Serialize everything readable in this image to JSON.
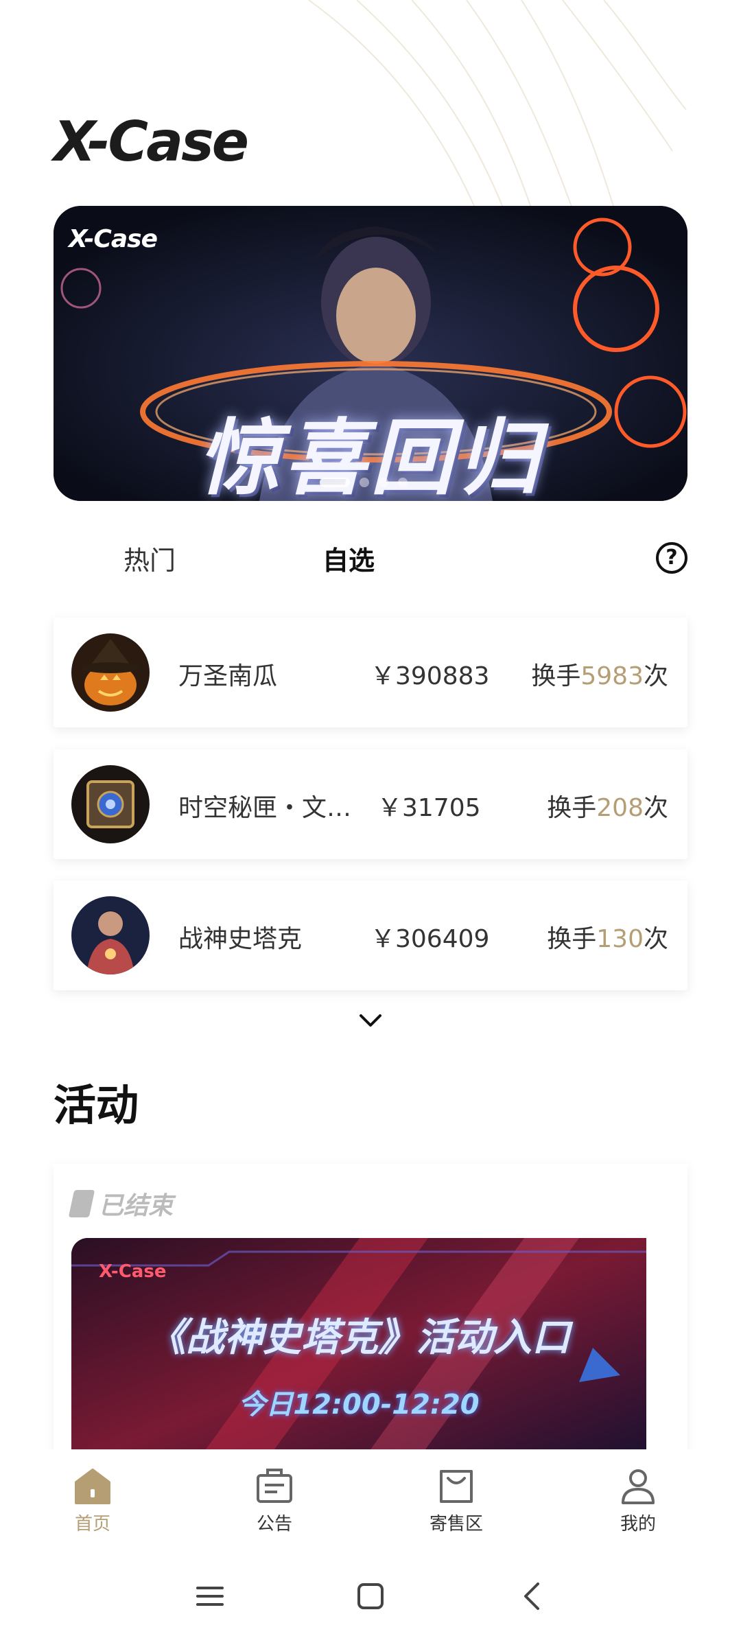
{
  "app": {
    "logo": "X-Case"
  },
  "banner": {
    "logo": "X-Case",
    "headline": "惊喜回归",
    "slides": 4,
    "active_slide": 1
  },
  "tabs": {
    "items": [
      {
        "label": "热门",
        "selected": false
      },
      {
        "label": "自选",
        "selected": true
      }
    ],
    "help_label": "?"
  },
  "list": {
    "items": [
      {
        "name": "万圣南瓜",
        "price": "￥390883",
        "trade_prefix": "换手",
        "trade_count": "5983",
        "trade_suffix": "次",
        "thumb": "pumpkin-icon"
      },
      {
        "name": "时空秘匣・文…",
        "price": "￥31705",
        "trade_prefix": "换手",
        "trade_count": "208",
        "trade_suffix": "次",
        "thumb": "mystery-box-icon"
      },
      {
        "name": "战神史塔克",
        "price": "￥306409",
        "trade_prefix": "换手",
        "trade_count": "130",
        "trade_suffix": "次",
        "thumb": "hero-icon"
      }
    ]
  },
  "activity": {
    "section_title": "活动",
    "status": "已结束",
    "card": {
      "logo": "X-Case",
      "title": "《战神史塔克》活动入口",
      "time": "今日12:00-12:20"
    }
  },
  "bottom_nav": {
    "items": [
      {
        "label": "首页",
        "icon": "home-icon",
        "active": true
      },
      {
        "label": "公告",
        "icon": "announcement-icon",
        "active": false
      },
      {
        "label": "寄售区",
        "icon": "bag-icon",
        "active": false
      },
      {
        "label": "我的",
        "icon": "profile-icon",
        "active": false
      }
    ]
  },
  "colors": {
    "accent": "#b59d74",
    "text": "#333333",
    "banner_bg": "#0e1320"
  }
}
